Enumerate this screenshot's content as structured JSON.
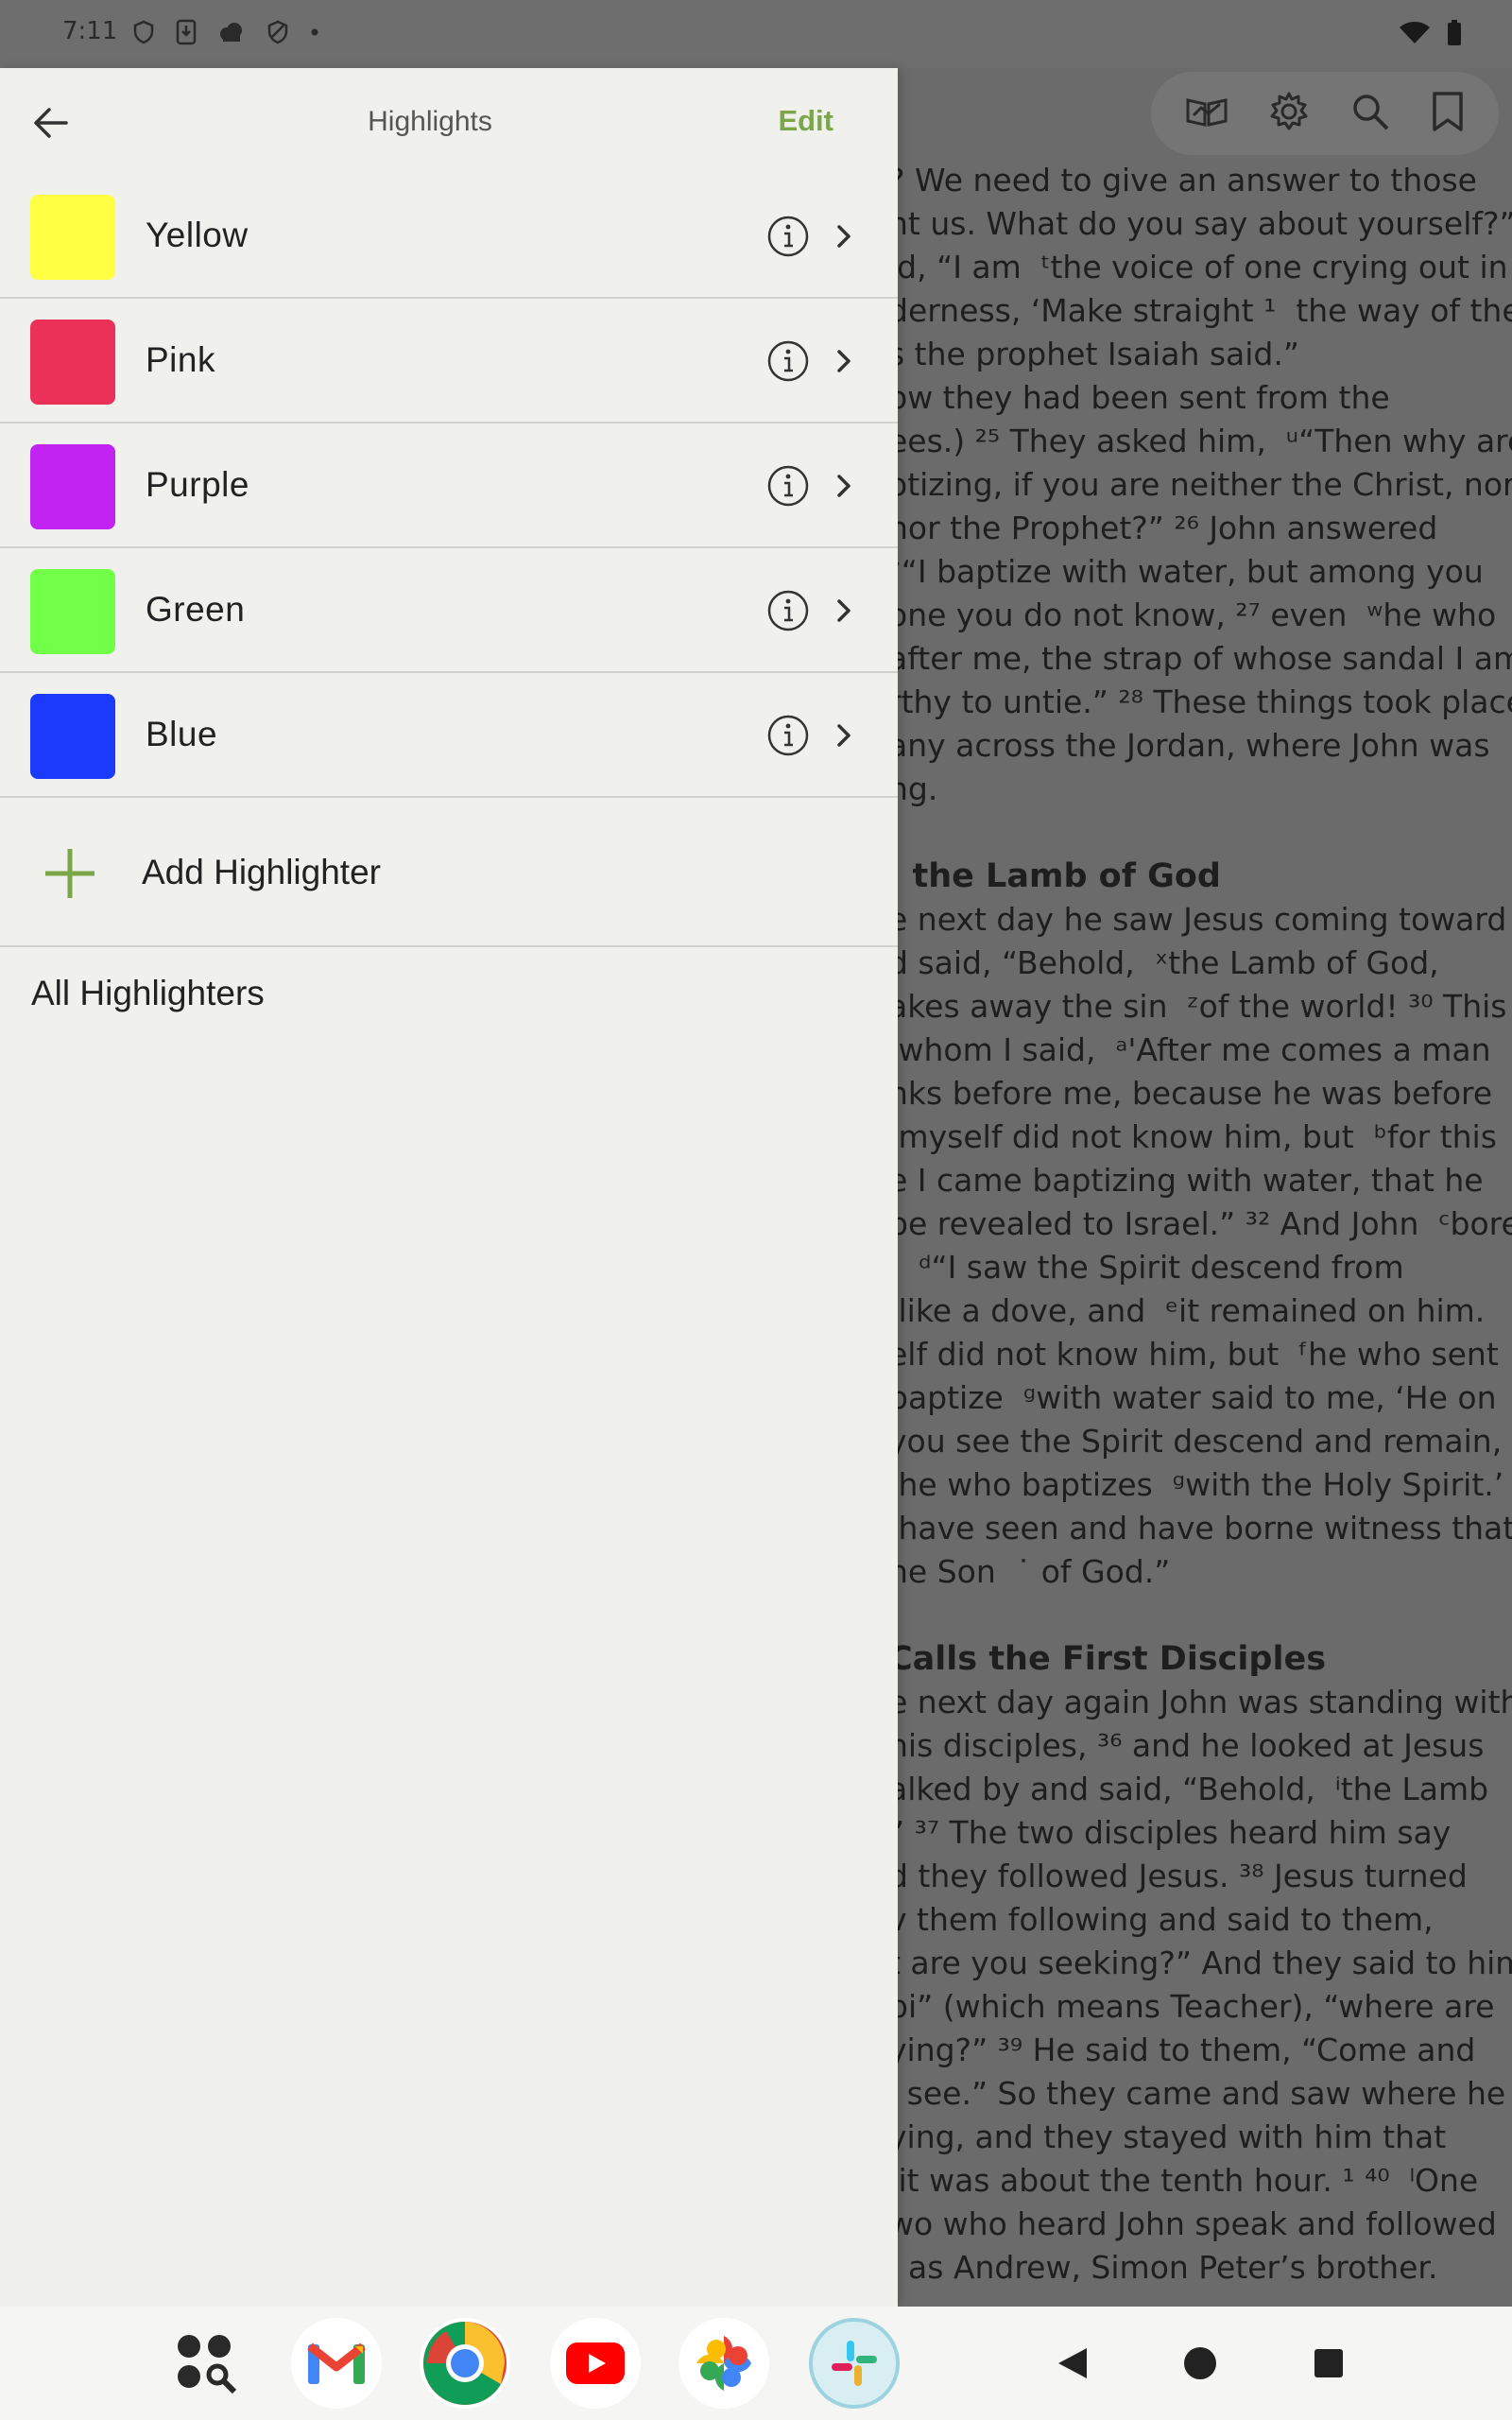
{
  "status_bar": {
    "time": "7:11"
  },
  "drawer": {
    "title": "Highlights",
    "edit_label": "Edit",
    "highlighters": [
      {
        "label": "Yellow",
        "color": "#ffff44"
      },
      {
        "label": "Pink",
        "color": "#ec3158"
      },
      {
        "label": "Purple",
        "color": "#c222f2"
      },
      {
        "label": "Green",
        "color": "#71ff47"
      },
      {
        "label": "Blue",
        "color": "#1c3afb"
      }
    ],
    "add_label": "Add Highlighter",
    "all_label": "All Highlighters"
  },
  "reader": {
    "lines": [
      "? We need to give an answer to those",
      "nt us. What do you say about yourself?”",
      "id, “I am  ᵗthe voice of one crying out in",
      "derness, ‘Make straight ¹  the way of the",
      "s the prophet Isaiah said.”",
      "ow they had been sent from the",
      "ees.) ²⁵ They asked him,  ᵘ“Then why are",
      "otizing, if you are neither the Christ, nor",
      "nor the Prophet?” ²⁶ John answered",
      "ᵛ“I baptize with water, but among you",
      "one you do not know, ²⁷ even  ʷhe who",
      "after me, the strap of whose sandal I am",
      "rthy to untie.” ²⁸ These things took place",
      "any across the Jordan, where John was",
      "ng.",
      "",
      "#, the Lamb of God",
      "e next day he saw Jesus coming toward",
      "d said, “Behold,  ˣthe Lamb of God,",
      "akes away the sin  ᶻof the world! ³⁰ This",
      " whom I said,  ᵃ'After me comes a man",
      "nks before me, because he was before",
      " myself did not know him, but  ᵇfor this",
      "e I came baptizing with water, that he",
      "be revealed to Israel.” ³² And John  ᶜbore",
      ":  ᵈ“I saw the Spirit descend from",
      " like a dove, and  ᵉit remained on him.",
      "elf did not know him, but  ᶠhe who sent",
      "baptize  ᵍwith water said to me, ‘He on",
      "you see the Spirit descend and remain,",
      " he who baptizes  ᵍwith the Holy Spirit.’",
      " have seen and have borne witness that",
      "he Son  ˙ of God.”",
      "",
      "#Calls the First Disciples",
      "e next day again John was standing with",
      "his disciples, ³⁶ and he looked at Jesus",
      "alked by and said, “Behold,  ⁱthe Lamb",
      "” ³⁷ The two disciples heard him say",
      "d they followed Jesus. ³⁸ Jesus turned",
      "v them following and said to them,",
      "t are you seeking?” And they said to him,",
      "bi” (which means Teacher), “where are",
      "ying?” ³⁹ He said to them, “Come and",
      "l see.” So they came and saw where he",
      "ying, and they stayed with him that",
      " it was about the tenth hour. ¹ ⁴⁰  ˡOne",
      "wo who heard John speak and followed",
      "  as Andrew, Simon Peter’s brother."
    ]
  }
}
